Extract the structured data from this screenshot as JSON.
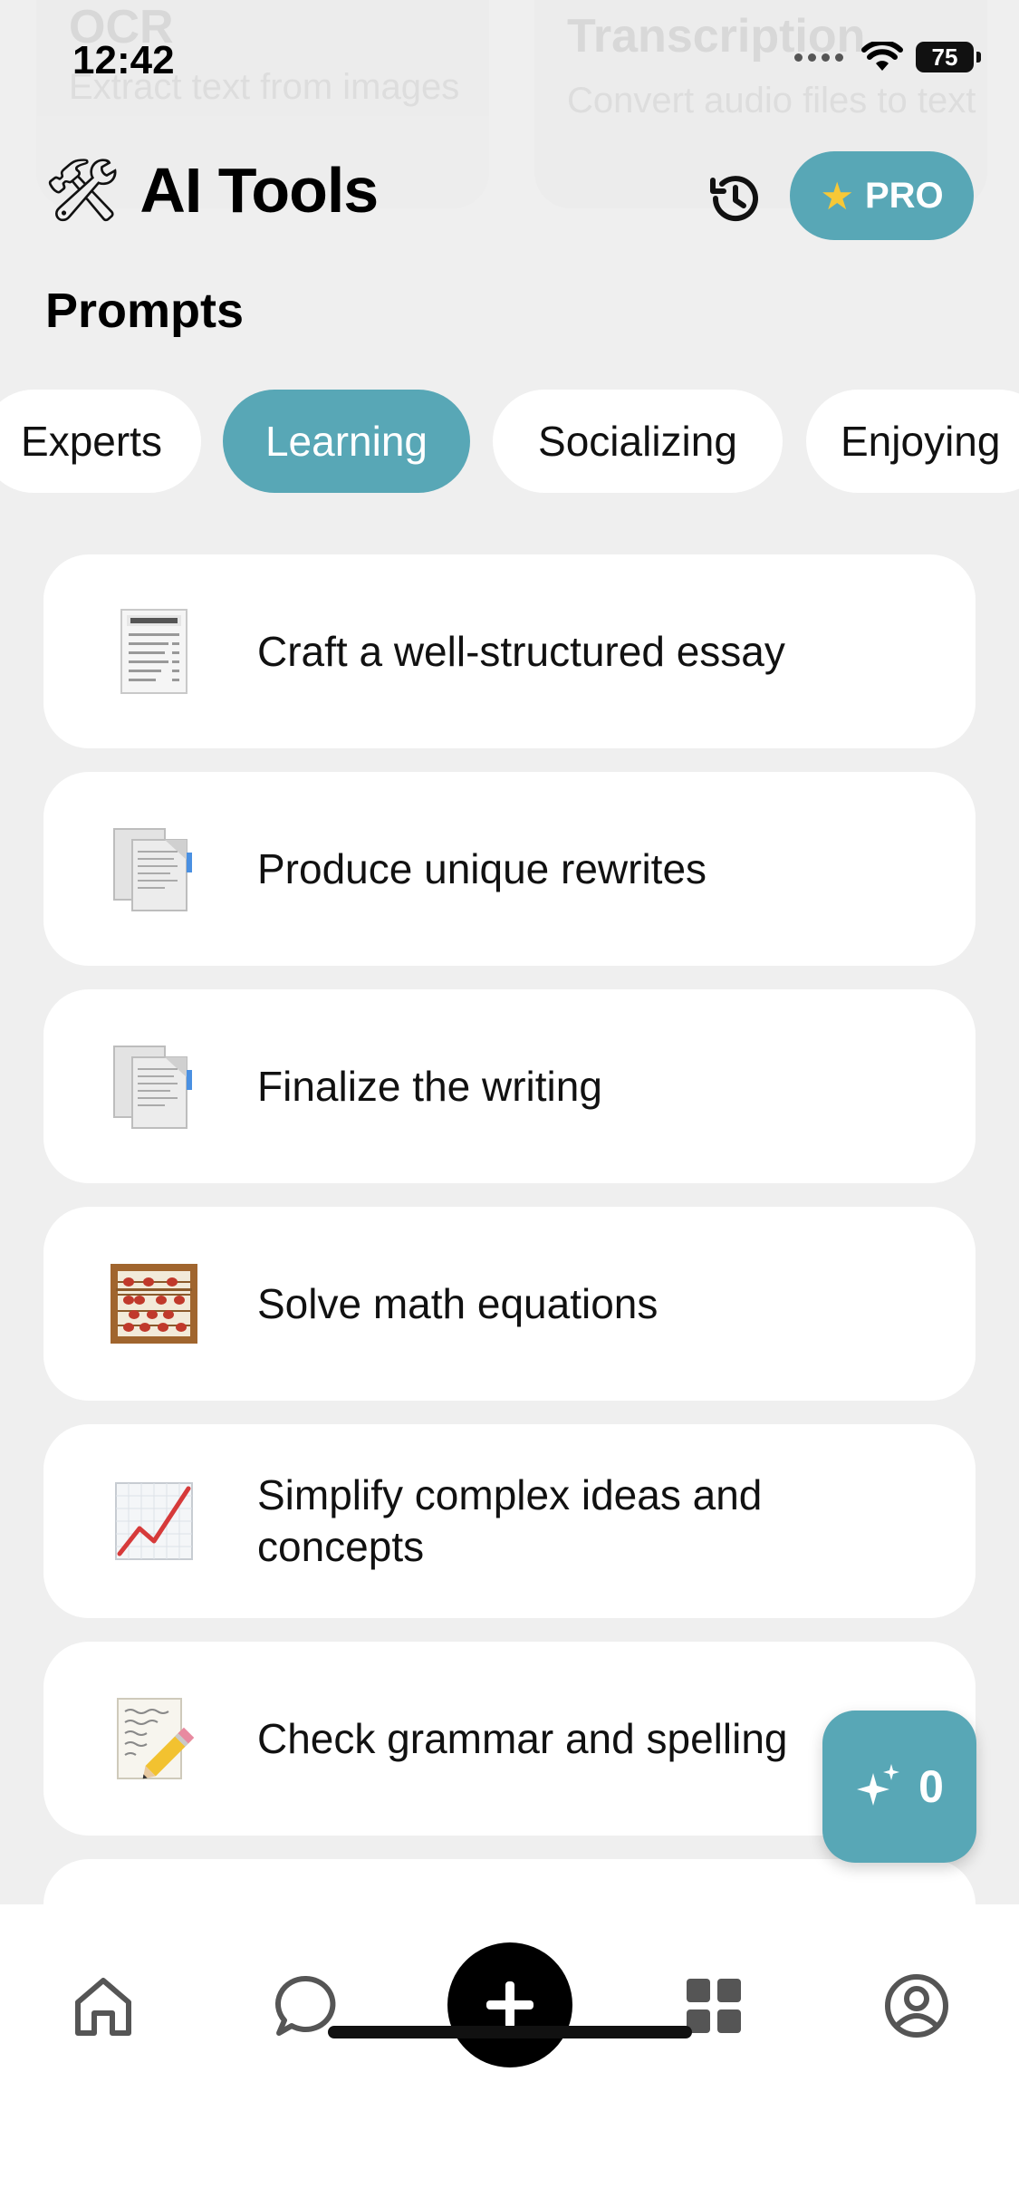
{
  "status_bar": {
    "time": "12:42",
    "battery": "75"
  },
  "background_cards": [
    {
      "title": "OCR",
      "subtitle": "Extract text from images"
    },
    {
      "title": "Transcription",
      "subtitle": "Convert audio files to text"
    }
  ],
  "header": {
    "title": "AI Tools",
    "pro_label": "PRO"
  },
  "section_title": "Prompts",
  "categories": [
    {
      "label": "Experts",
      "active": false
    },
    {
      "label": "Learning",
      "active": true
    },
    {
      "label": "Socializing",
      "active": false
    },
    {
      "label": "Enjoying",
      "active": false
    }
  ],
  "prompts": [
    {
      "label": "Craft a well-structured essay",
      "icon": "receipt-icon"
    },
    {
      "label": "Produce unique rewrites",
      "icon": "documents-icon"
    },
    {
      "label": "Finalize the writing",
      "icon": "documents-icon"
    },
    {
      "label": "Solve math equations",
      "icon": "abacus-icon"
    },
    {
      "label": "Simplify complex ideas and concepts",
      "icon": "chart-increasing-icon"
    },
    {
      "label": "Check grammar and spelling",
      "icon": "memo-pencil-icon"
    }
  ],
  "credits": {
    "count": "0"
  },
  "tabbar": [
    "home-icon",
    "chat-icon",
    "plus-icon",
    "apps-grid-icon",
    "profile-icon"
  ],
  "colors": {
    "accent": "#58a7b6",
    "background": "#efefef",
    "card": "#ffffff"
  }
}
